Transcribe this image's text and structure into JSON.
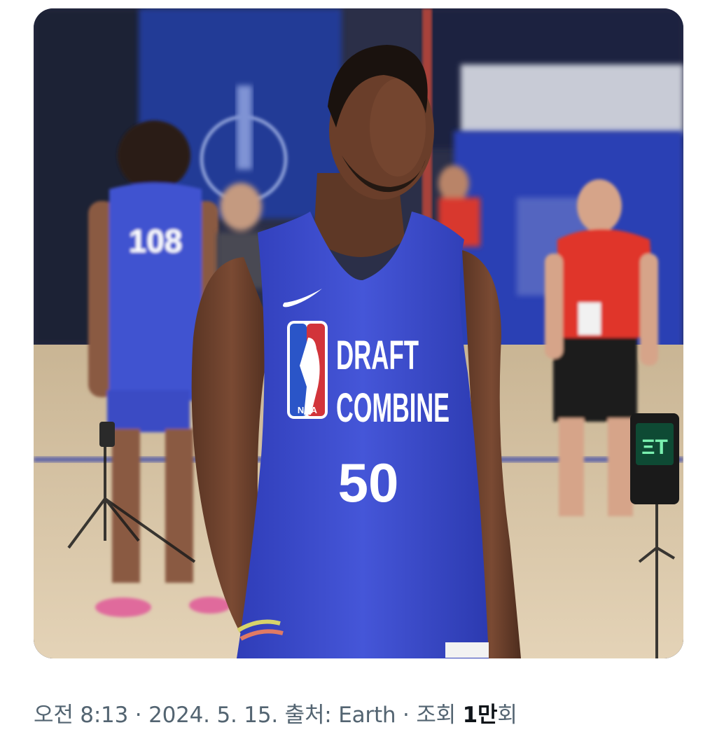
{
  "post": {
    "photo": {
      "alt_subject": "basketball-player-photo",
      "back_jersey_number": "108",
      "jersey_number": "50",
      "jersey_text_line1": "DRAFT",
      "jersey_text_line2": "COMBINE",
      "logo_text": "NBA",
      "colors": {
        "jersey": "#3f4fd0",
        "court": "#d9c7a8",
        "wall": "#2a3fa8",
        "staff_shirt": "#e0352b"
      }
    },
    "meta": {
      "time": "오전 8:13",
      "sep1": " · ",
      "date": "2024. 5. 15.",
      "source_label": " 출처: ",
      "source": "Earth",
      "sep2": " · ",
      "views_label": "조회 ",
      "views_value": "1만",
      "views_suffix": "회"
    },
    "colors": {
      "meta_text": "#536471",
      "meta_strong": "#0f1419"
    }
  }
}
